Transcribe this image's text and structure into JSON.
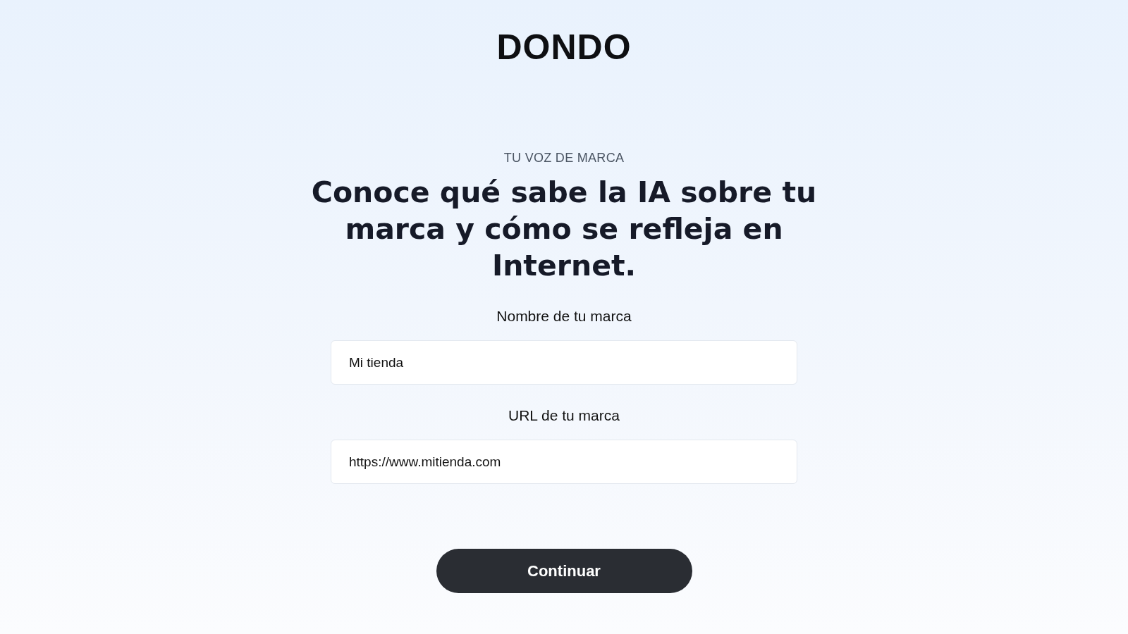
{
  "logo": {
    "text": "DONDO"
  },
  "eyebrow": "TU VOZ DE MARCA",
  "heading": "Conoce qué sabe la IA sobre tu marca y cómo se refleja en Internet.",
  "fields": [
    {
      "label": "Nombre de tu marca",
      "value": "Mi tienda"
    },
    {
      "label": "URL de tu marca",
      "value": "https://www.mitienda.com"
    }
  ],
  "button": {
    "label": "Continuar"
  }
}
